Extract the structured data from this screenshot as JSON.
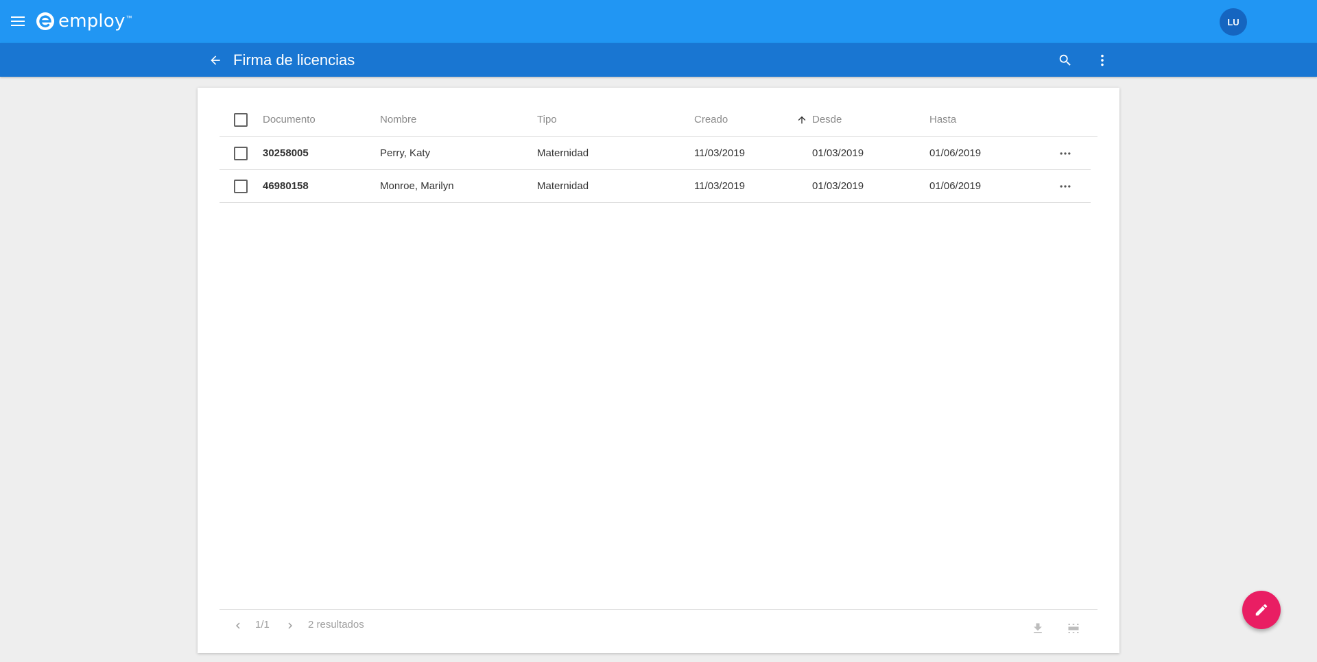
{
  "app": {
    "brand": "employ",
    "avatar_initials": "LU"
  },
  "subbar": {
    "title": "Firma de licencias"
  },
  "table": {
    "columns": [
      "Documento",
      "Nombre",
      "Tipo",
      "Creado",
      "Desde",
      "Hasta"
    ],
    "sort_column": "Desde",
    "sort_direction": "ascending",
    "rows": [
      {
        "documento": "30258005",
        "nombre": "Perry, Katy",
        "tipo": "Maternidad",
        "creado": "11/03/2019",
        "desde": "01/03/2019",
        "hasta": "01/06/2019"
      },
      {
        "documento": "46980158",
        "nombre": "Monroe, Marilyn",
        "tipo": "Maternidad",
        "creado": "11/03/2019",
        "desde": "01/03/2019",
        "hasta": "01/06/2019"
      }
    ]
  },
  "footer": {
    "page": "1/1",
    "results": "2 resultados"
  },
  "colors": {
    "topbar": "#2196f3",
    "subbar": "#1976d2",
    "avatar": "#1565c0",
    "fab": "#e91e63"
  },
  "icons": [
    "menu-icon",
    "logo-icon",
    "arrow-back-icon",
    "search-icon",
    "more-vert-icon",
    "arrow-up-icon",
    "more-horiz-icon",
    "chevron-left-icon",
    "chevron-right-icon",
    "download-icon",
    "columns-icon",
    "pencil-icon"
  ]
}
